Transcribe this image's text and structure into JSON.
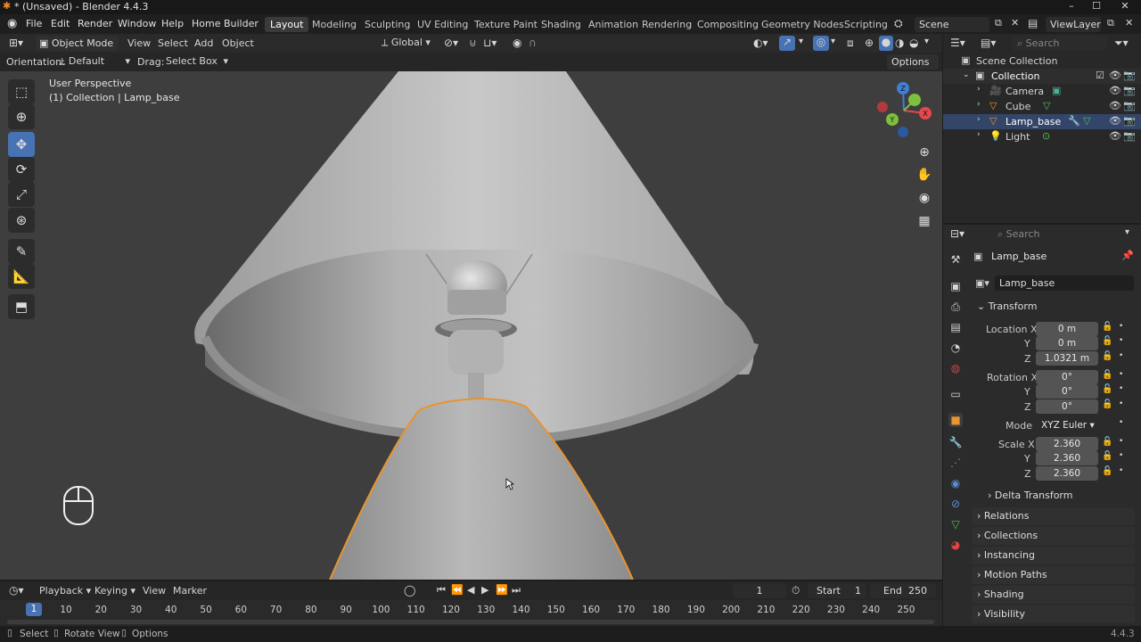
{
  "window": {
    "title": "* (Unsaved) - Blender 4.4.3",
    "minimize": "–",
    "maximize": "☐",
    "close": "✕"
  },
  "menu": [
    "File",
    "Edit",
    "Render",
    "Window",
    "Help",
    "Home Builder"
  ],
  "workspaces": [
    "Layout",
    "Modeling",
    "Sculpting",
    "UV Editing",
    "Texture Paint",
    "Shading",
    "Animation",
    "Rendering",
    "Compositing",
    "Geometry Nodes",
    "Scripting"
  ],
  "scene": {
    "name": "Scene",
    "view_layer": "ViewLayer"
  },
  "viewport_header": {
    "mode": "Object Mode",
    "menus": [
      "View",
      "Select",
      "Add",
      "Object"
    ],
    "transform_orientation": "Global",
    "orientation_label": "Orientation:",
    "orientation_value": "Default",
    "drag_label": "Drag:",
    "drag_value": "Select Box",
    "options": "Options"
  },
  "viewport": {
    "perspective": "User Perspective",
    "context": "(1) Collection | Lamp_base"
  },
  "gizmo": {
    "x": "X",
    "y": "Y",
    "z": "Z"
  },
  "outliner": {
    "search_placeholder": "Search",
    "root": "Scene Collection",
    "collection": "Collection",
    "items": [
      "Camera",
      "Cube",
      "Lamp_base",
      "Light"
    ]
  },
  "properties": {
    "search_placeholder": "Search",
    "object_name": "Lamp_base",
    "data_name": "Lamp_base",
    "transform": "Transform",
    "location_label": "Location X",
    "y_label": "Y",
    "z_label": "Z",
    "location": [
      "0 m",
      "0 m",
      "1.0321 m"
    ],
    "rotation_label": "Rotation X",
    "rotation": [
      "0°",
      "0°",
      "0°"
    ],
    "mode_label": "Mode",
    "mode_value": "XYZ Euler",
    "scale_label": "Scale X",
    "scale": [
      "2.360",
      "2.360",
      "2.360"
    ],
    "delta": "Delta Transform",
    "panels": [
      "Relations",
      "Collections",
      "Instancing",
      "Motion Paths",
      "Shading",
      "Visibility"
    ]
  },
  "timeline": {
    "menus": [
      "Playback",
      "Keying",
      "View",
      "Marker"
    ],
    "current_frame": "1",
    "start_label": "Start",
    "start": "1",
    "end_label": "End",
    "end": "250",
    "playhead": "1",
    "ticks": [
      "10",
      "20",
      "30",
      "40",
      "50",
      "60",
      "70",
      "80",
      "90",
      "100",
      "110",
      "120",
      "130",
      "140",
      "150",
      "160",
      "170",
      "180",
      "190",
      "200",
      "210",
      "220",
      "230",
      "240",
      "250"
    ]
  },
  "status": {
    "select": "Select",
    "rotate": "Rotate View",
    "options": "Options",
    "version": "4.4.3"
  },
  "colors": {
    "accent": "#4772b3",
    "selection_outline": "#e8942f",
    "viewport_bg": "#3e3e3e",
    "x_axis": "#e5484d",
    "y_axis": "#7fbf3f",
    "z_axis": "#3f7fd6"
  }
}
